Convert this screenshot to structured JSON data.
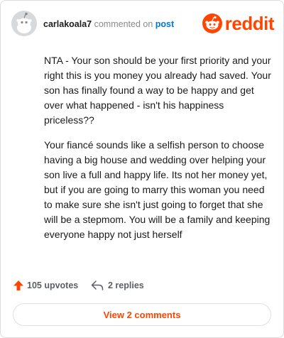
{
  "comment": {
    "username": "carlakoala7",
    "action_text": "commented on",
    "post_link": "post",
    "brand": "reddit",
    "paragraphs": [
      "NTA - Your son should be your first priority and your right this is you money you already had saved. Your son has finally found a way to be happy and get over what happened - isn't his happiness priceless??",
      "Your fiancé sounds like a selfish person to choose having a big house and wedding over helping your son live a full and happy life. Its not her money yet, but if you are going to marry this woman you need to make sure she isn't just going to forget that she will be a stepmom. You will be a family and keeping everyone happy not just herself"
    ],
    "upvotes_label": "105 upvotes",
    "replies_label": "2 replies",
    "view_comments_label": "View 2 comments"
  },
  "colors": {
    "brand": "#ff4500",
    "link": "#0079d3",
    "muted": "#878a8c"
  },
  "icons": {
    "avatar": "snoo-avatar",
    "brand": "reddit-logo-icon",
    "upvote": "upvote-arrow-icon",
    "reply": "reply-arrow-icon"
  }
}
